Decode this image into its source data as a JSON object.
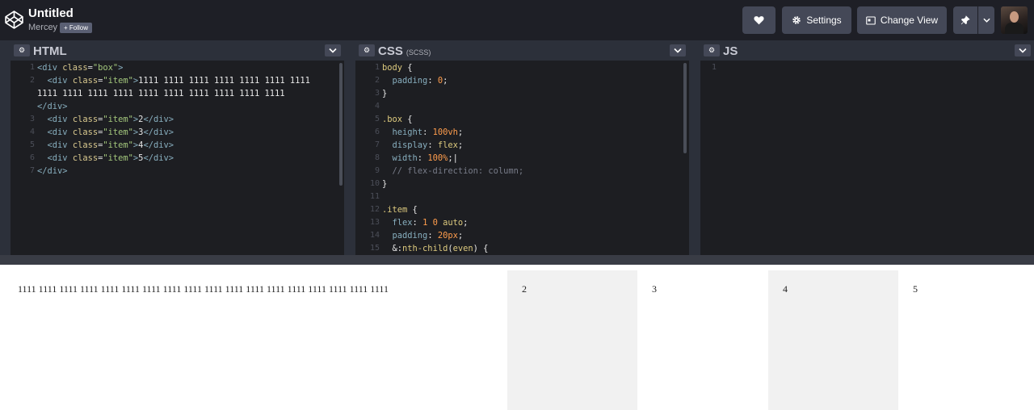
{
  "header": {
    "title": "Untitled",
    "author": "Mercey",
    "follow_label": "+ Follow",
    "settings_label": "Settings",
    "change_view_label": "Change View"
  },
  "panels": {
    "html": {
      "title": "HTML"
    },
    "css": {
      "title": "CSS",
      "subtitle": "(SCSS)"
    },
    "js": {
      "title": "JS"
    }
  },
  "html_code": {
    "line_numbers": [
      "1",
      "2",
      "",
      "",
      "3",
      "4",
      "5",
      "6",
      "7"
    ],
    "lines": [
      "<div class=\"box\">",
      "  <div class=\"item\">1111 1111 1111 1111 1111 1111 1111",
      "1111 1111 1111 1111 1111 1111 1111 1111 1111 1111",
      "</div>",
      "  <div class=\"item\">2</div>",
      "  <div class=\"item\">3</div>",
      "  <div class=\"item\">4</div>",
      "  <div class=\"item\">5</div>",
      "</div>"
    ]
  },
  "css_code": {
    "line_numbers": [
      "1",
      "2",
      "3",
      "4",
      "5",
      "6",
      "7",
      "8",
      "9",
      "10",
      "11",
      "12",
      "13",
      "14",
      "15"
    ],
    "lines": [
      "body {",
      "  padding: 0;",
      "}",
      "",
      ".box {",
      "  height: 100vh;",
      "  display: flex;",
      "  width: 100%;",
      "  // flex-direction: column;",
      "}",
      "",
      ".item {",
      "  flex: 1 0 auto;",
      "  padding: 20px;",
      "  &:nth-child(even) {"
    ]
  },
  "js_code": {
    "line_numbers": [
      "1"
    ]
  },
  "preview": {
    "items": [
      "1111 1111 1111 1111 1111 1111 1111 1111 1111 1111 1111 1111 1111 1111 1111 1111 1111 1111",
      "2",
      "3",
      "4",
      "5"
    ]
  },
  "colors": {
    "header_bg": "#1e1f26",
    "editor_bg": "#1d1e22",
    "button_bg": "#444857",
    "even_item_bg": "#f1f1f1"
  },
  "icons": [
    "codepen-logo-icon",
    "heart-icon",
    "gear-icon",
    "change-view-icon",
    "pin-icon",
    "chevron-down-icon"
  ]
}
